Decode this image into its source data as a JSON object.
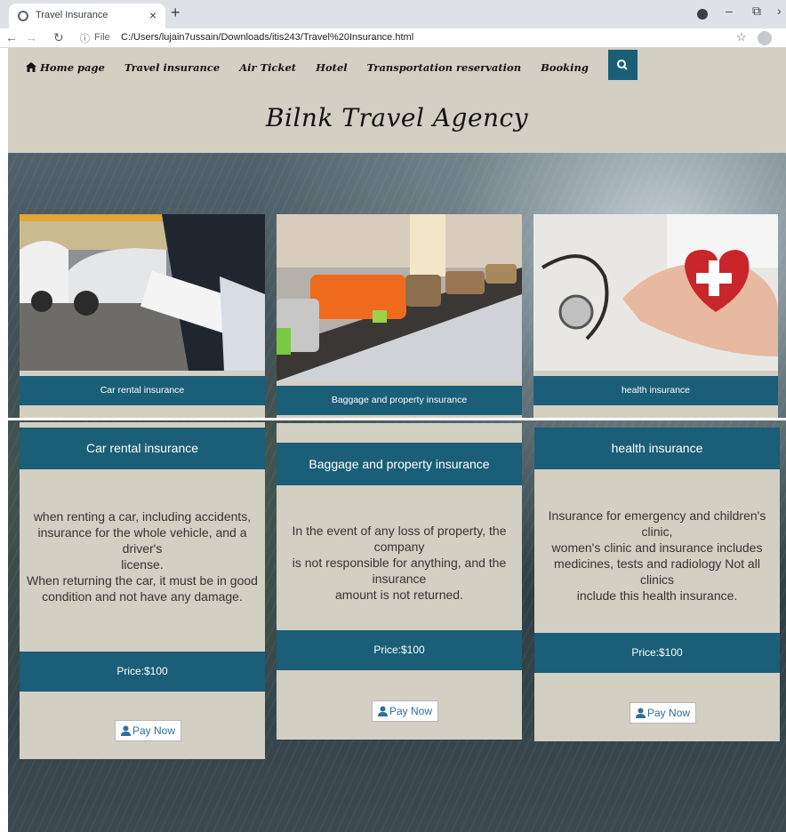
{
  "browser": {
    "tab_title": "Travel Insurance",
    "new_tab_icon": "plus-icon",
    "url_scheme": "File",
    "url": "C:/Users/lujain7ussain/Downloads/itis243/Travel%20Insurance.html"
  },
  "nav": {
    "items": [
      {
        "label": "Home page",
        "icon": "home-icon"
      },
      {
        "label": "Travel insurance"
      },
      {
        "label": "Air Ticket"
      },
      {
        "label": "Hotel"
      },
      {
        "label": "Transportation reservation"
      },
      {
        "label": "Booking"
      }
    ],
    "search_icon": "search-icon"
  },
  "brand": "Bilnk Travel Agency",
  "products": [
    {
      "label": "Car rental insurance",
      "image": "car-rental-photo"
    },
    {
      "label": "Baggage and property insurance",
      "image": "luggage-conveyor-photo"
    },
    {
      "label": "health insurance",
      "image": "stethoscope-heart-photo"
    }
  ],
  "details": [
    {
      "title": "Car rental insurance",
      "lines": [
        "when renting a car, including accidents,",
        "insurance for the whole vehicle, and a driver's",
        "license.",
        "When returning the car, it must be in good",
        "condition and not have any damage."
      ],
      "price": "Price:$100",
      "button": "Pay Now"
    },
    {
      "title": "Baggage and property insurance",
      "lines": [
        "In the event of any loss of property, the company",
        "is not responsible for anything, and the insurance",
        "amount is not returned."
      ],
      "price": "Price:$100",
      "button": "Pay Now"
    },
    {
      "title": "health insurance",
      "lines": [
        "Insurance for emergency and children's clinic,",
        "women's clinic and insurance includes",
        "medicines, tests and radiology Not all clinics",
        "include this health insurance."
      ],
      "price": "Price:$100",
      "button": "Pay Now"
    }
  ],
  "colors": {
    "accent": "#1a5e77",
    "panel": "#d3cfc3"
  }
}
